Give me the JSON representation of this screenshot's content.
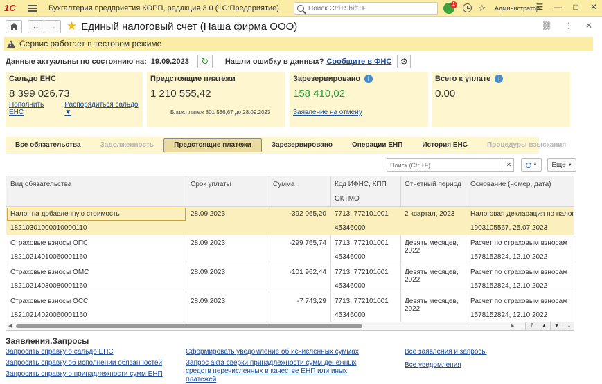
{
  "titlebar": {
    "logo": "1С",
    "app_title": "Бухгалтерия предприятия КОРП, редакция 3.0  (1С:Предприятие)",
    "search_placeholder": "Поиск Ctrl+Shift+F",
    "notification_count": "1",
    "user": "Администратор",
    "window_controls": [
      "☰",
      "—",
      "□",
      "✕"
    ]
  },
  "form": {
    "title": "Единый налоговый счет (Наша фирма ООО)",
    "head_actions": [
      "🔗",
      "⋮",
      "✕"
    ]
  },
  "test_bar": {
    "text": "Сервис работает в тестовом режиме"
  },
  "actual": {
    "label": "Данные актуальны по состоянию на:",
    "date": "19.09.2023",
    "error_label": "Нашли ошибку в данных?",
    "error_link": "Сообщите в ФНС"
  },
  "cards": {
    "saldo": {
      "title": "Сальдо ЕНС",
      "value": "8 399 026,73",
      "link1": "Пополнить ЕНС",
      "link2": "Распорядиться сальдо ▼"
    },
    "upcoming": {
      "title": "Предстоящие платежи",
      "value": "1 210 555,42",
      "note": "Ближ.платеж 801 536,67 до 28.09.2023"
    },
    "reserved": {
      "title": "Зарезервировано",
      "value": "158 410,02",
      "link": "Заявление на отмену"
    },
    "total": {
      "title": "Всего к уплате",
      "value": "0.00"
    }
  },
  "tabs": [
    {
      "label": "Все обязательства",
      "state": "normal"
    },
    {
      "label": "Задолженность",
      "state": "disabled"
    },
    {
      "label": "Предстоящие платежи",
      "state": "active"
    },
    {
      "label": "Зарезервировано",
      "state": "normal"
    },
    {
      "label": "Операции ЕНП",
      "state": "normal"
    },
    {
      "label": "История ЕНС",
      "state": "normal"
    },
    {
      "label": "Процедуры взыскания",
      "state": "disabled"
    }
  ],
  "table_toolbar": {
    "search_placeholder": "Поиск (Ctrl+F)",
    "more_label": "Еще"
  },
  "table": {
    "headers": {
      "type": "Вид обязательства",
      "due": "Срок уплаты",
      "sum": "Сумма",
      "codes": "Код ИФНС, КПП",
      "oktmo": "ОКТМО",
      "period": "Отчетный период",
      "basis": "Основание (номер, дата)"
    },
    "rows": [
      {
        "type": "Налог на добавленную стоимость",
        "kbk": "18210301000010000110",
        "due": "28.09.2023",
        "sum": "-392 065,20",
        "codes": "7713, 772101001",
        "oktmo": "45346000",
        "period": "2 квартал, 2023",
        "basis": "Налоговая декларация по налогу на",
        "basis2": "1903105567, 25.07.2023"
      },
      {
        "type": "Страховые взносы ОПС",
        "kbk": "18210214010060001160",
        "due": "28.09.2023",
        "sum": "-299 765,74",
        "codes": "7713, 772101001",
        "oktmo": "45346000",
        "period": "Девять месяцев, 2022",
        "basis": "Расчет по страховым взносам",
        "basis2": "1578152824, 12.10.2022"
      },
      {
        "type": "Страховые взносы ОМС",
        "kbk": "18210214030080001160",
        "due": "28.09.2023",
        "sum": "-101 962,44",
        "codes": "7713, 772101001",
        "oktmo": "45346000",
        "period": "Девять месяцев, 2022",
        "basis": "Расчет по страховым взносам",
        "basis2": "1578152824, 12.10.2022"
      },
      {
        "type": "Страховые взносы ОСС",
        "kbk": "18210214020060001160",
        "due": "28.09.2023",
        "sum": "-7 743,29",
        "codes": "7713, 772101001",
        "oktmo": "45346000",
        "period": "Девять месяцев, 2022",
        "basis": "Расчет по страховым взносам",
        "basis2": "1578152824, 12.10.2022"
      }
    ]
  },
  "requests": {
    "title": "Заявления.Запросы",
    "col1": [
      "Запросить справку о сальдо ЕНС",
      "Запросить справку об исполнении обязанностей",
      "Запросить справку о принадлежности сумм ЕНП"
    ],
    "col2": [
      "Сформировать уведомление об исчисленных суммах",
      "Запрос акта сверки принадлежности сумм денежных средств перечисленных в качестве ЕНП или иных платежей"
    ],
    "col3": [
      "Все заявления и запросы",
      "Все уведомления"
    ]
  },
  "colors": {
    "accent": "#fbeda6",
    "card_bg": "#fdf6cf",
    "link": "#1c4e9c",
    "reserved_value": "#2c9c3f"
  }
}
